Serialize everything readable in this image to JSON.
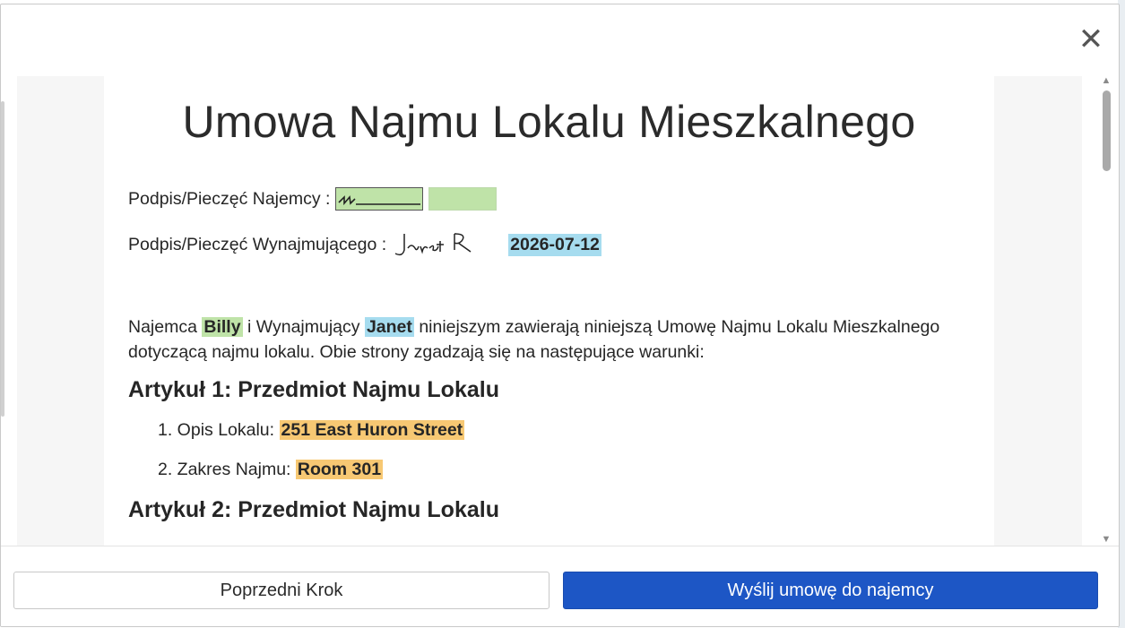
{
  "dialog": {
    "close_symbol": "✕",
    "close_icon": "close-icon"
  },
  "document": {
    "title": "Umowa Najmu Lokalu Mieszkalnego",
    "tenant_signature_label": "Podpis/Pieczęć Najemcy :",
    "landlord_signature_label": "Podpis/Pieczęć Wynajmującego :",
    "landlord_signature_handwriting": "Janet R",
    "sign_date": "2026-07-12",
    "intro": {
      "part1": "Najemca",
      "tenant_name": "Billy",
      "part2": "i Wynajmujący",
      "landlord_name": "Janet",
      "part3": "niniejszym zawierają niniejszą Umowę Najmu Lokalu Mieszkalnego dotyczącą najmu lokalu. Obie strony zgadzają się na następujące warunki:"
    },
    "articles": [
      {
        "heading": "Artykuł 1: Przedmiot Najmu Lokalu",
        "items": [
          {
            "label": "1. Opis Lokalu:",
            "value": "251 East Huron Street"
          },
          {
            "label": "2. Zakres Najmu:",
            "value": "Room 301"
          }
        ]
      },
      {
        "heading": "Artykuł 2: Przedmiot Najmu Lokalu"
      }
    ]
  },
  "footer": {
    "prev_button": "Poprzedni Krok",
    "send_button": "Wyślij umowę do najemcy"
  },
  "colors": {
    "highlight_green": "#bfe3a8",
    "highlight_blue": "#a6dcef",
    "highlight_orange": "#f7c873",
    "primary_button": "#1d56c5"
  }
}
